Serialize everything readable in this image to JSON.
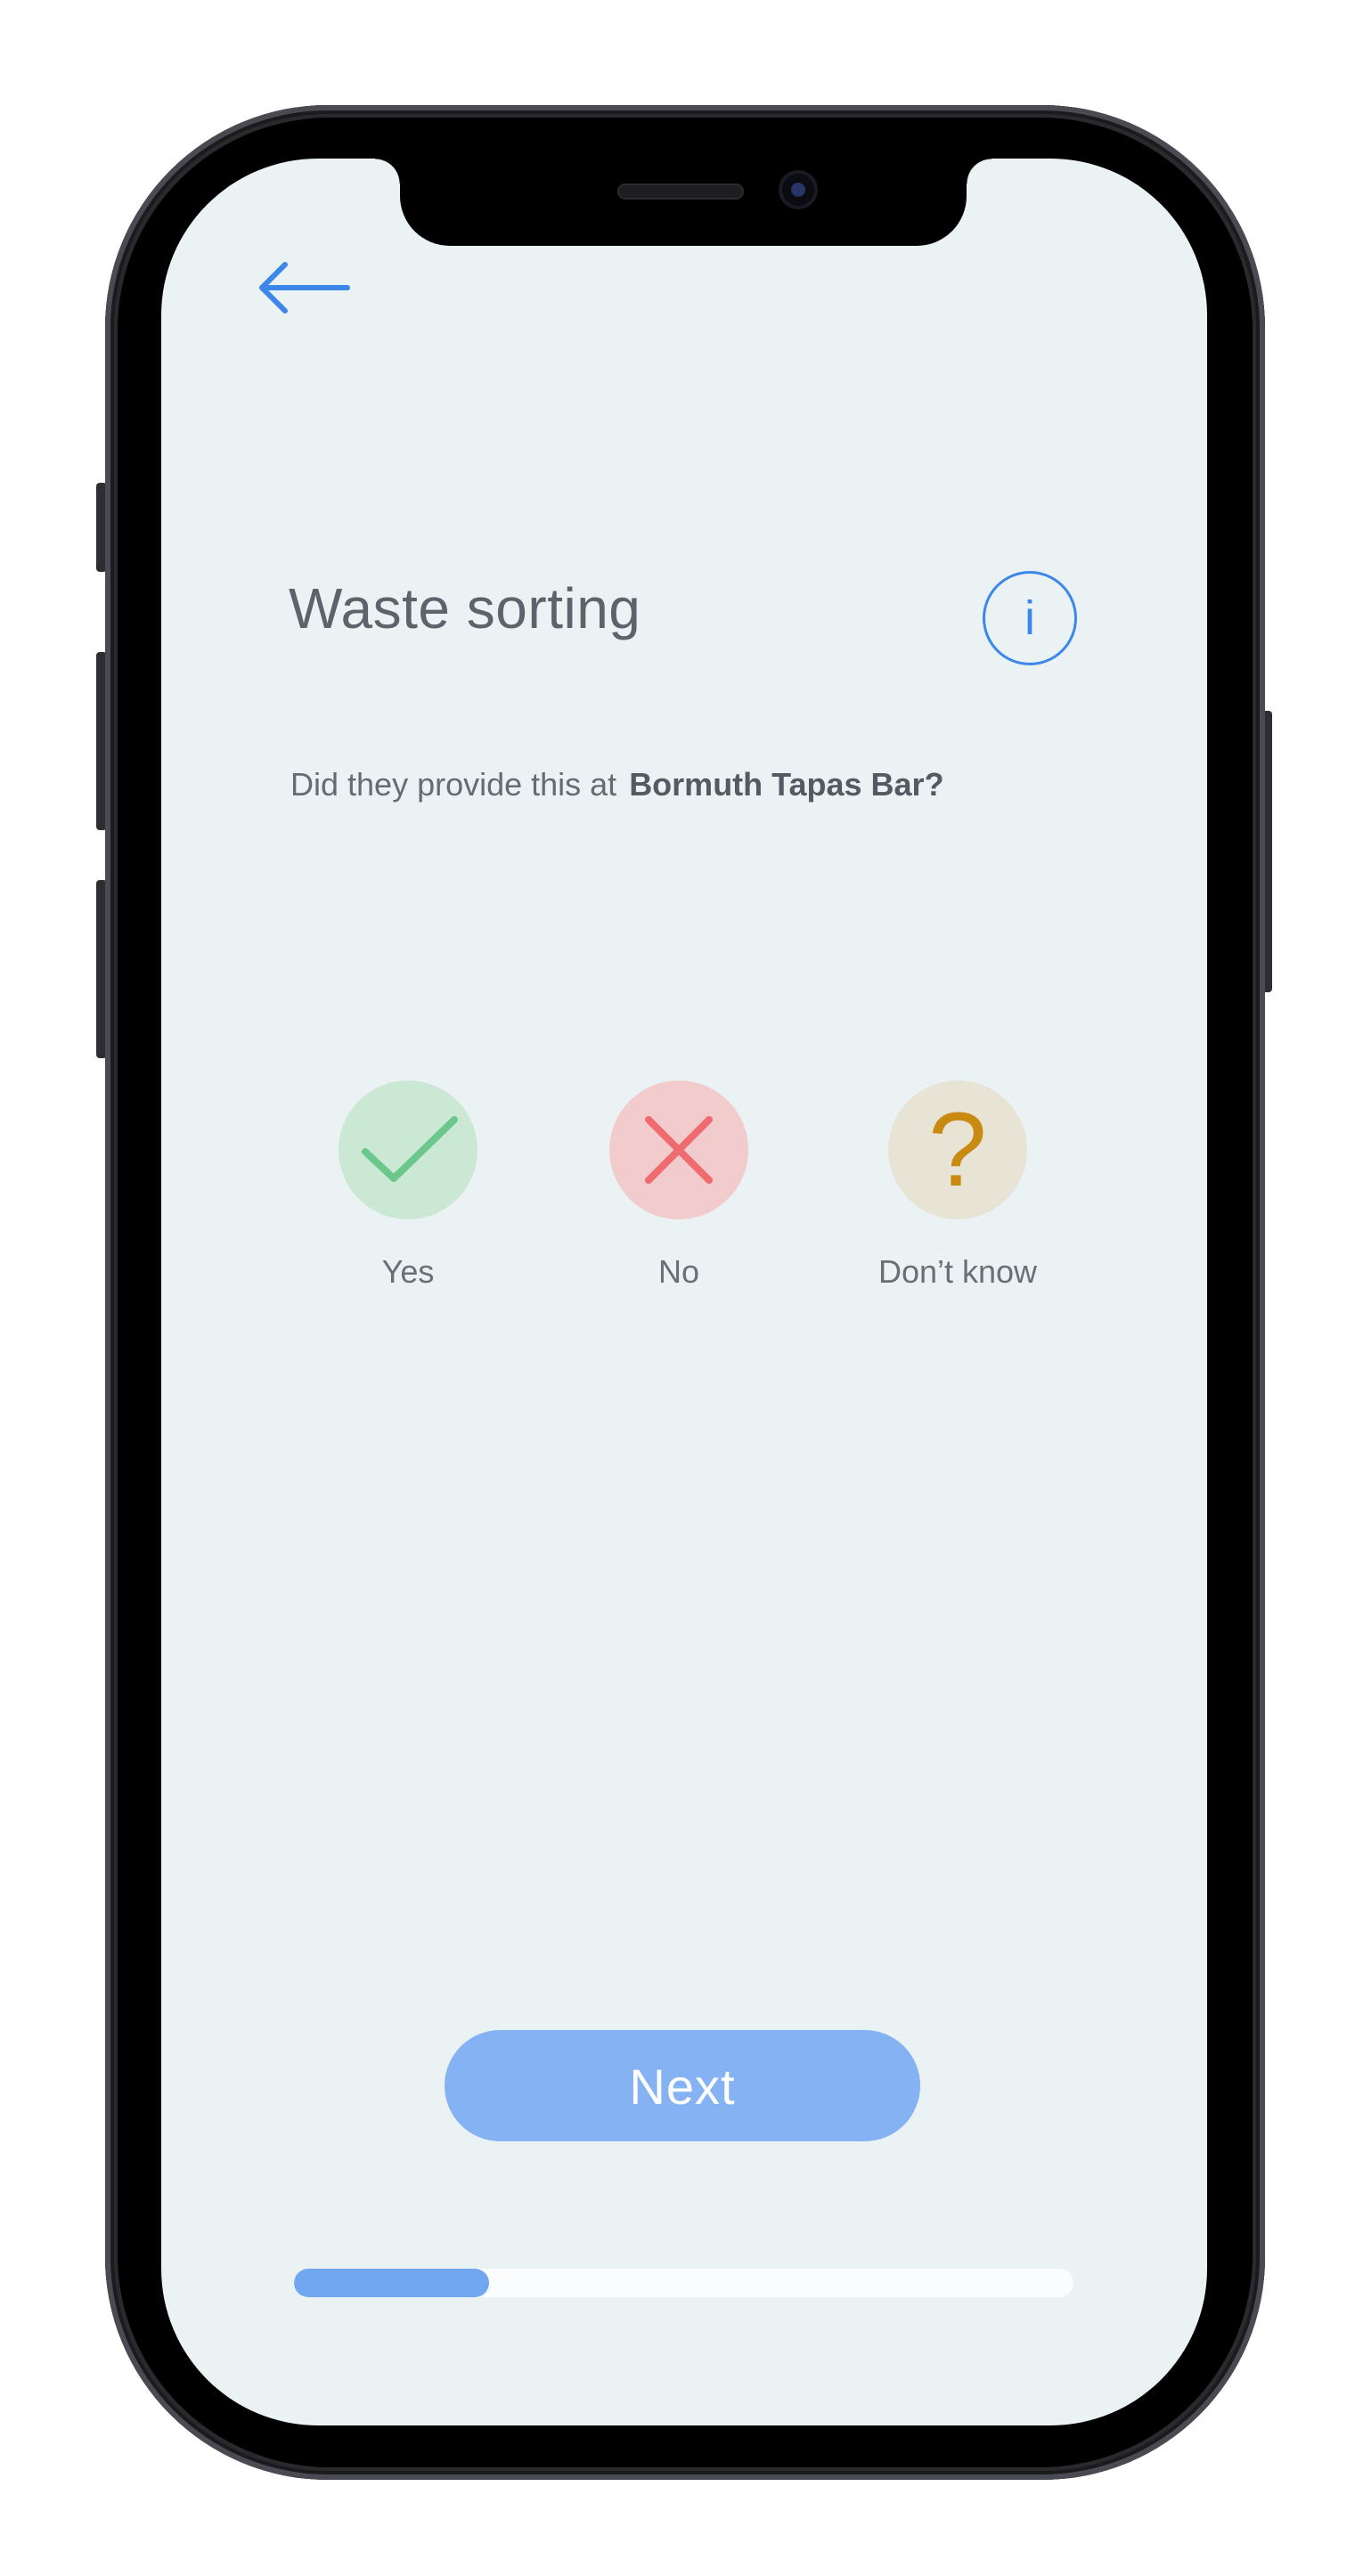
{
  "header": {
    "back_icon": "arrow-left-icon",
    "title": "Waste sorting",
    "info_label": "i",
    "info_icon": "info-icon"
  },
  "question": {
    "prefix": "Did they provide this at",
    "venue": "Bormuth Tapas Bar?"
  },
  "options": [
    {
      "label": "Yes",
      "icon": "check-icon",
      "color": "#6cc78c"
    },
    {
      "label": "No",
      "icon": "cross-icon",
      "color": "#ef6b6f"
    },
    {
      "label": "Don’t know",
      "icon": "question-icon",
      "glyph": "?",
      "color": "#c98a12"
    }
  ],
  "footer": {
    "next_label": "Next",
    "progress": 0.25
  },
  "colors": {
    "accent": "#3d87ea",
    "screen_bg": "#eaf2f4",
    "button_bg": "#84b2f2"
  }
}
